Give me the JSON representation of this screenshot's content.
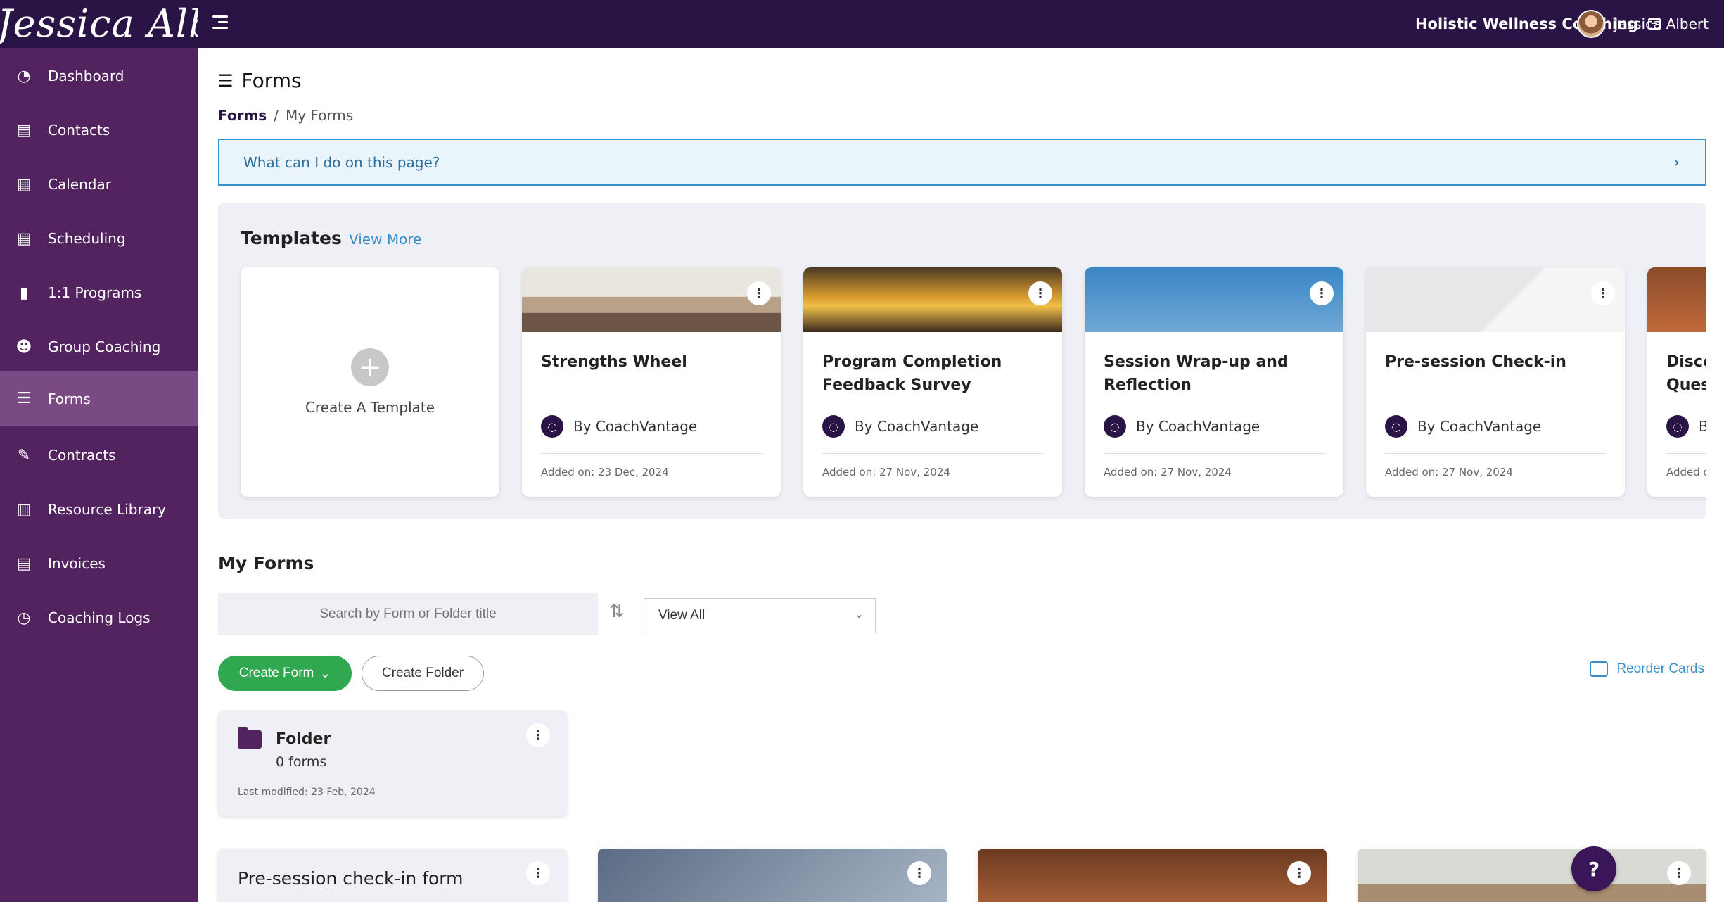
{
  "app": {
    "logo_text": "Jessica Albert",
    "brand_name": "Holistic Wellness Coaching",
    "user_name": "Jessica Albert"
  },
  "sidebar": {
    "items": [
      {
        "label": "Dashboard",
        "icon": "gauge-icon"
      },
      {
        "label": "Contacts",
        "icon": "contact-book-icon"
      },
      {
        "label": "Calendar",
        "icon": "calendar-icon"
      },
      {
        "label": "Scheduling",
        "icon": "calendar-clock-icon"
      },
      {
        "label": "1:1 Programs",
        "icon": "book-icon"
      },
      {
        "label": "Group Coaching",
        "icon": "people-icon"
      },
      {
        "label": "Forms",
        "icon": "checklist-icon"
      },
      {
        "label": "Contracts",
        "icon": "signature-icon"
      },
      {
        "label": "Resource Library",
        "icon": "books-icon"
      },
      {
        "label": "Invoices",
        "icon": "invoice-icon"
      },
      {
        "label": "Coaching Logs",
        "icon": "clock-icon"
      }
    ],
    "active": "Forms"
  },
  "page": {
    "title": "Forms",
    "breadcrumb": {
      "root": "Forms",
      "separator": "/",
      "current": "My Forms"
    },
    "help_text": "What can I do on this page?"
  },
  "templates": {
    "title": "Templates",
    "view_more": "View More",
    "create_label": "Create A Template",
    "cards": [
      {
        "name": "Strengths Wheel",
        "by": "By CoachVantage",
        "added": "Added on: 23 Dec, 2024"
      },
      {
        "name": "Program Completion Feedback Survey",
        "by": "By CoachVantage",
        "added": "Added on: 27 Nov, 2024"
      },
      {
        "name": "Session Wrap-up and Reflection",
        "by": "By CoachVantage",
        "added": "Added on: 27 Nov, 2024"
      },
      {
        "name": "Pre-session Check-in",
        "by": "By CoachVantage",
        "added": "Added on: 27 Nov, 2024"
      },
      {
        "name": "Disco\nQues",
        "by": "B",
        "added": "Added o"
      }
    ]
  },
  "my_forms": {
    "title": "My Forms",
    "search_placeholder": "Search by Form or Folder title",
    "filter_value": "View All",
    "create_form": "Create Form",
    "create_folder": "Create Folder",
    "reorder": "Reorder Cards",
    "folder": {
      "name": "Folder",
      "count": "0 forms",
      "modified": "Last modified: 23 Feb, 2024"
    },
    "form_cards": [
      {
        "title": "Pre-session check-in form"
      }
    ]
  },
  "help_button": "?",
  "colors": {
    "topbar": "#2a1446",
    "sidebar": "#52235e",
    "sidebar_active": "#7a4a85",
    "accent_blue": "#3a8fc8",
    "green": "#2fa84f"
  }
}
